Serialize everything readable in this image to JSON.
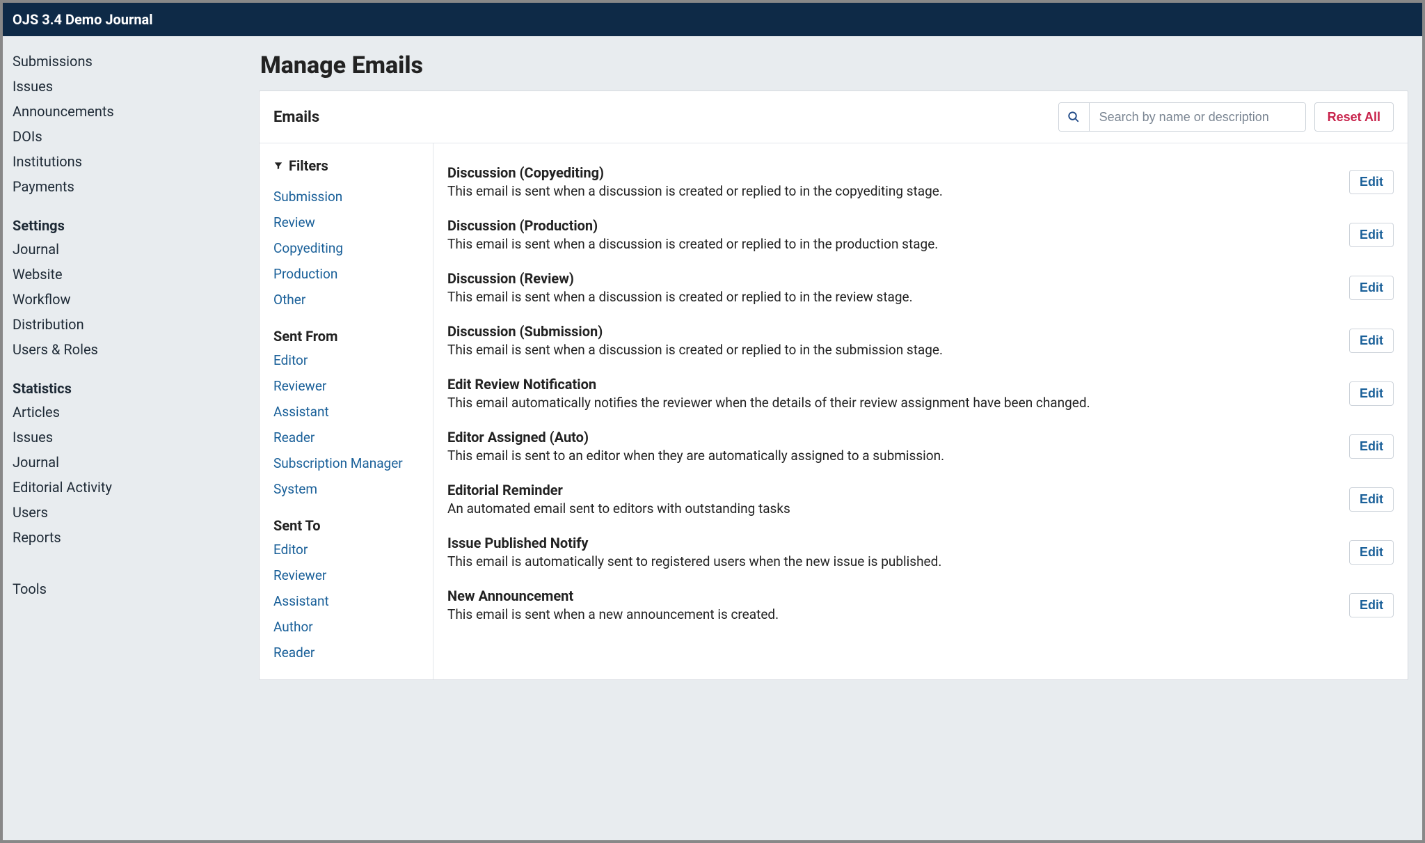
{
  "topbar": {
    "title": "OJS 3.4 Demo Journal"
  },
  "sidebar": {
    "primary": [
      "Submissions",
      "Issues",
      "Announcements",
      "DOIs",
      "Institutions",
      "Payments"
    ],
    "settings_heading": "Settings",
    "settings": [
      "Journal",
      "Website",
      "Workflow",
      "Distribution",
      "Users & Roles"
    ],
    "stats_heading": "Statistics",
    "stats": [
      "Articles",
      "Issues",
      "Journal",
      "Editorial Activity",
      "Users",
      "Reports"
    ],
    "tools_heading": "Tools"
  },
  "page": {
    "title": "Manage Emails"
  },
  "panel": {
    "heading": "Emails",
    "search_placeholder": "Search by name or description",
    "reset_label": "Reset All",
    "edit_label": "Edit",
    "filters_label": "Filters",
    "filter_groups": [
      {
        "title": "",
        "items": [
          "Submission",
          "Review",
          "Copyediting",
          "Production",
          "Other"
        ]
      },
      {
        "title": "Sent From",
        "items": [
          "Editor",
          "Reviewer",
          "Assistant",
          "Reader",
          "Subscription Manager",
          "System"
        ]
      },
      {
        "title": "Sent To",
        "items": [
          "Editor",
          "Reviewer",
          "Assistant",
          "Author",
          "Reader"
        ]
      }
    ],
    "emails": [
      {
        "title": "Discussion (Copyediting)",
        "desc": "This email is sent when a discussion is created or replied to in the copyediting stage."
      },
      {
        "title": "Discussion (Production)",
        "desc": "This email is sent when a discussion is created or replied to in the production stage."
      },
      {
        "title": "Discussion (Review)",
        "desc": "This email is sent when a discussion is created or replied to in the review stage."
      },
      {
        "title": "Discussion (Submission)",
        "desc": "This email is sent when a discussion is created or replied to in the submission stage."
      },
      {
        "title": "Edit Review Notification",
        "desc": "This email automatically notifies the reviewer when the details of their review assignment have been changed."
      },
      {
        "title": "Editor Assigned (Auto)",
        "desc": "This email is sent to an editor when they are automatically assigned to a submission."
      },
      {
        "title": "Editorial Reminder",
        "desc": "An automated email sent to editors with outstanding tasks"
      },
      {
        "title": "Issue Published Notify",
        "desc": "This email is automatically sent to registered users when the new issue is published."
      },
      {
        "title": "New Announcement",
        "desc": "This email is sent when a new announcement is created."
      }
    ]
  }
}
